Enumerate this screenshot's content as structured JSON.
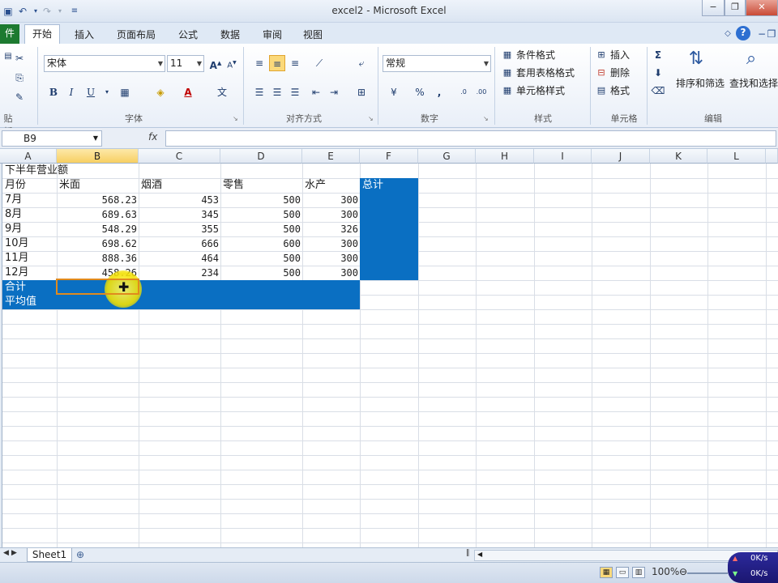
{
  "window": {
    "title": "excel2 - Microsoft Excel"
  },
  "tabs": [
    {
      "label": "件",
      "kind": "file"
    },
    {
      "label": "开始",
      "kind": "active"
    },
    {
      "label": "插入"
    },
    {
      "label": "页面布局"
    },
    {
      "label": "公式"
    },
    {
      "label": "数据"
    },
    {
      "label": "审阅"
    },
    {
      "label": "视图"
    }
  ],
  "ribbon": {
    "font_name": "宋体",
    "font_size": "11",
    "number_format": "常规",
    "bold": "B",
    "italic": "I",
    "underline": "U",
    "styles": {
      "cond_format": "条件格式",
      "table_format": "套用表格格式",
      "cell_styles": "单元格样式"
    },
    "cells": {
      "insert": "插入",
      "delete": "删除",
      "format": "格式"
    },
    "editing": {
      "sort_filter": "排序和筛选",
      "find_select": "查找和选择"
    },
    "groups": {
      "clipboard": "贴板",
      "font": "字体",
      "alignment": "对齐方式",
      "number": "数字",
      "styles": "样式",
      "cells": "单元格",
      "editing": "编辑"
    },
    "percent": "%",
    "comma": ","
  },
  "formula_bar": {
    "name_box": "B9",
    "fx": "fx",
    "value": ""
  },
  "columns": [
    "A",
    "B",
    "C",
    "D",
    "E",
    "F",
    "G",
    "H",
    "I",
    "J",
    "K",
    "L"
  ],
  "selected_column": "B",
  "sheet": {
    "title": "下半年营业额",
    "headers": [
      "月份",
      "米面",
      "烟酒",
      "零售",
      "水产",
      "总计"
    ],
    "rows": [
      {
        "month": "7月",
        "b": "568.23",
        "c": "453",
        "d": "500",
        "e": "300"
      },
      {
        "month": "8月",
        "b": "689.63",
        "c": "345",
        "d": "500",
        "e": "300"
      },
      {
        "month": "9月",
        "b": "548.29",
        "c": "355",
        "d": "500",
        "e": "326"
      },
      {
        "month": "10月",
        "b": "698.62",
        "c": "666",
        "d": "600",
        "e": "300"
      },
      {
        "month": "11月",
        "b": "888.36",
        "c": "464",
        "d": "500",
        "e": "300"
      },
      {
        "month": "12月",
        "b": "458.26",
        "c": "234",
        "d": "500",
        "e": "300"
      }
    ],
    "total_label": "合计",
    "avg_label": "平均值"
  },
  "sheet_tabs": [
    {
      "label": "Sheet1",
      "active": true
    }
  ],
  "status": {
    "zoom": "100%"
  },
  "netmon": {
    "up": "0K/s",
    "down": "0K/s"
  },
  "colors": {
    "fill_blue": "#0a6fc2",
    "selection_border": "#e08a1e",
    "file_tab": "#1d7a30"
  }
}
